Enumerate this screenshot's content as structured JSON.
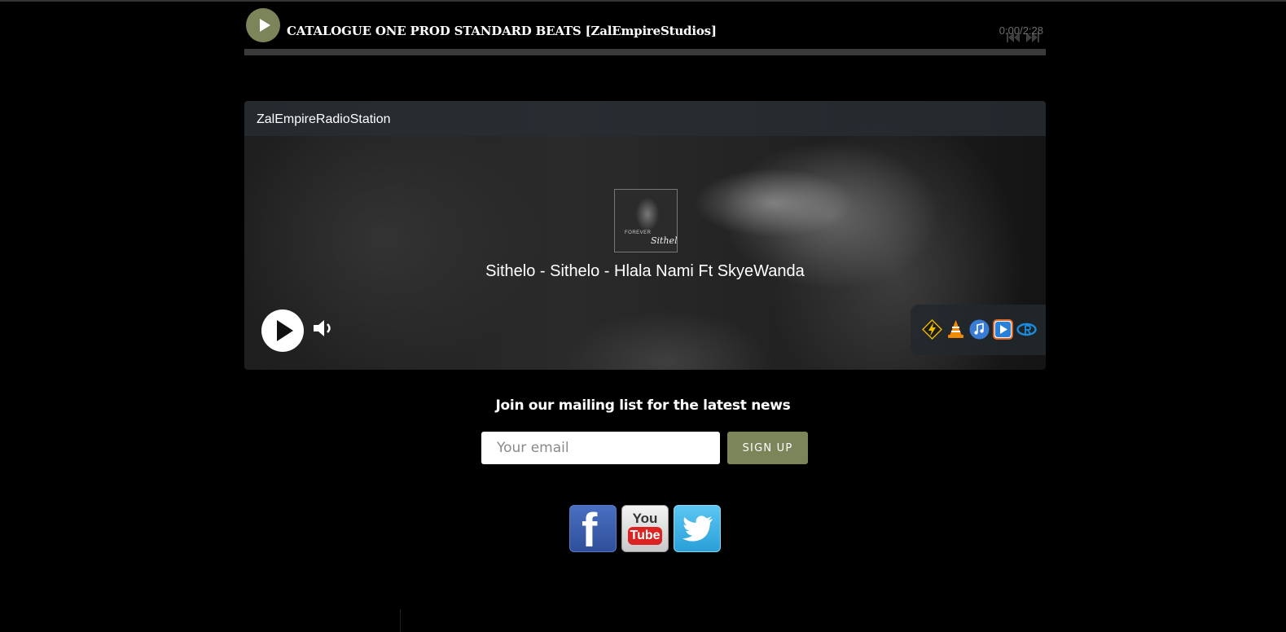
{
  "audio_player": {
    "title": "CATALOGUE ONE PROD STANDARD BEATS [ZalEmpireStudios]",
    "time": "0:00/2:28",
    "progress": 0,
    "accent_color": "#7c8559",
    "icons": [
      "play-icon",
      "previous-icon",
      "next-icon"
    ]
  },
  "radio": {
    "station_name": "ZalEmpireRadioStation",
    "now_playing": "Sithelo - Sithelo - Hlala Nami Ft SkyeWanda",
    "album_art": {
      "caption": "FOREVER",
      "signature": "Sithelo"
    },
    "controls": [
      "play-icon",
      "volume-icon"
    ],
    "player_links": [
      "winamp-icon",
      "vlc-icon",
      "itunes-icon",
      "windows-media-player-icon",
      "realplayer-icon"
    ]
  },
  "mailing_list": {
    "title": "Join our mailing list for the latest news",
    "email_placeholder": "Your email",
    "signup_label": "SIGN UP"
  },
  "social": {
    "facebook": {
      "icon": "facebook-icon",
      "letter": "f"
    },
    "youtube": {
      "icon": "youtube-icon",
      "you": "You",
      "tube": "Tube"
    },
    "twitter": {
      "icon": "twitter-icon"
    }
  }
}
